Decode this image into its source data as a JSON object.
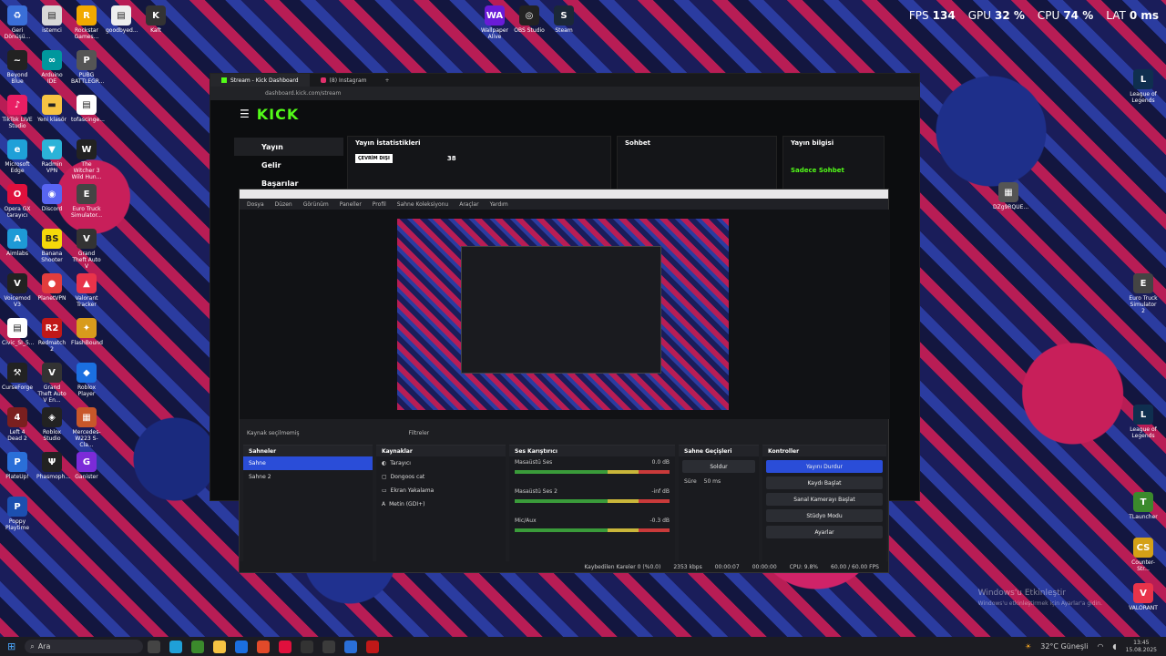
{
  "stats": [
    {
      "label": "FPS",
      "value": "134"
    },
    {
      "label": "GPU",
      "value": "32 %"
    },
    {
      "label": "CPU",
      "value": "74 %"
    },
    {
      "label": "LAT",
      "value": "0 ms"
    }
  ],
  "desktop_icons_left": [
    {
      "label": "Geri Dönüşü...",
      "color": "#3a6fd8",
      "glyph": "♻"
    },
    {
      "label": "istemci",
      "color": "#d8d8d8",
      "glyph": "▤"
    },
    {
      "label": "Rockstar Games...",
      "color": "#f2a900",
      "glyph": "R"
    },
    {
      "label": "goodbyed...",
      "color": "#eee",
      "glyph": "▤"
    },
    {
      "label": "Kaft",
      "color": "#333",
      "glyph": "K"
    },
    {
      "label": "Beyond Blue",
      "color": "#222",
      "glyph": "~"
    },
    {
      "label": "Arduino IDE",
      "color": "#00979d",
      "glyph": "∞"
    },
    {
      "label": "PUBG BATTLEGR...",
      "color": "#555",
      "glyph": "P"
    },
    {
      "label": "TikTok LIVE Studio",
      "color": "#e91e63",
      "glyph": "♪"
    },
    {
      "label": "Yeni klasör",
      "color": "#f6c343",
      "glyph": "▬"
    },
    {
      "label": "tofascinge...",
      "color": "#fff",
      "glyph": "▤"
    },
    {
      "label": "Microsoft Edge",
      "color": "#1fa0d8",
      "glyph": "e"
    },
    {
      "label": "Radmin VPN",
      "color": "#2bb3d8",
      "glyph": "▼"
    },
    {
      "label": "The Witcher 3 Wild Hun...",
      "color": "#222",
      "glyph": "W"
    },
    {
      "label": "Opera GX tarayıcı",
      "color": "#e0103d",
      "glyph": "O"
    },
    {
      "label": "Discord",
      "color": "#5865f2",
      "glyph": "◉"
    },
    {
      "label": "Euro Truck Simulator...",
      "color": "#444",
      "glyph": "E"
    },
    {
      "label": "Aimlabs",
      "color": "#1e9ad6",
      "glyph": "A"
    },
    {
      "label": "Banana Shooter",
      "color": "#f5d90a",
      "glyph": "BS"
    },
    {
      "label": "Grand Theft Auto V",
      "color": "#333",
      "glyph": "V"
    },
    {
      "label": "Voicemod V3",
      "color": "#222",
      "glyph": "V"
    },
    {
      "label": "PlanetVPN",
      "color": "#e23d3d",
      "glyph": "●"
    },
    {
      "label": "Valorant Tracker",
      "color": "#e8334a",
      "glyph": "▲"
    },
    {
      "label": "Civic_SI_5...",
      "color": "#fff",
      "glyph": "▤"
    },
    {
      "label": "Redmatch 2",
      "color": "#c01818",
      "glyph": "R2"
    },
    {
      "label": "FlashBound",
      "color": "#d89b1c",
      "glyph": "✦"
    },
    {
      "label": "CurseForge",
      "color": "#222",
      "glyph": "⚒"
    },
    {
      "label": "Grand Theft Auto V En...",
      "color": "#333",
      "glyph": "V"
    },
    {
      "label": "Roblox Player",
      "color": "#1b6fe0",
      "glyph": "◆"
    },
    {
      "label": "Left 4 Dead 2",
      "color": "#7a1f1f",
      "glyph": "4"
    },
    {
      "label": "Roblox Studio",
      "color": "#222",
      "glyph": "◈"
    },
    {
      "label": "Mercedes-W223 S-Cla...",
      "color": "#c8572a",
      "glyph": "▦"
    },
    {
      "label": "PlateUp!",
      "color": "#2a6fd8",
      "glyph": "P"
    },
    {
      "label": "Phasmoph...",
      "color": "#222",
      "glyph": "Ψ"
    },
    {
      "label": "Ganister",
      "color": "#7c2bd8",
      "glyph": "G"
    },
    {
      "label": "Poppy Playtime",
      "color": "#1c4fb0",
      "glyph": "P"
    }
  ],
  "desktop_icons_top": [
    {
      "label": "Wallpaper Alive",
      "color": "#6a1bd8",
      "glyph": "WA"
    },
    {
      "label": "OBS Studio",
      "color": "#222",
      "glyph": "◎"
    },
    {
      "label": "Steam",
      "color": "#1b2838",
      "glyph": "S"
    }
  ],
  "desktop_icons_right": [
    {
      "label": "League of Legends",
      "color": "#0f2f4f",
      "glyph": "L"
    },
    {
      "label": "DZg9RQUE...",
      "color": "#555",
      "glyph": "▦"
    },
    {
      "label": "Euro Truck Simulator 2",
      "color": "#444",
      "glyph": "E"
    },
    {
      "label": "League of Legends",
      "color": "#0f2f4f",
      "glyph": "L"
    },
    {
      "label": "TLauncher",
      "color": "#3b8a2c",
      "glyph": "T"
    },
    {
      "label": "Counter-Str...",
      "color": "#d4a017",
      "glyph": "CS"
    },
    {
      "label": "VALORANT",
      "color": "#e8334a",
      "glyph": "V"
    }
  ],
  "browser": {
    "tabs": [
      {
        "label": "Stream - Kick Dashboard"
      },
      {
        "label": "(8) Instagram"
      }
    ],
    "url": "dashboard.kick.com/stream",
    "logo": "KICK",
    "sidebar": [
      "Yayın",
      "Gelir",
      "Başarılar"
    ],
    "panels": {
      "stats_title": "Yayın İstatistikleri",
      "stats_badge": "ÇEVRİM DIŞI",
      "stats_value": "38",
      "chat_title": "Sohbet",
      "info_title": "Yayın bilgisi",
      "info_chat": "Sadece Sohbet"
    }
  },
  "obs": {
    "menu": [
      "Dosya",
      "Düzen",
      "Görünüm",
      "Paneller",
      "Profil",
      "Sahne Koleksiyonu",
      "Araçlar",
      "Yardım"
    ],
    "source_bar_label": "Kaynak seçilmemiş",
    "filters_label": "Filtreler",
    "docks": {
      "scenes": {
        "title": "Sahneler",
        "items": [
          "Sahne",
          "Sahne 2"
        ]
      },
      "sources": {
        "title": "Kaynaklar",
        "items": [
          "Tarayıcı",
          "Dongoos cat",
          "Ekran Yakalama",
          "Metin (GDI+)"
        ]
      },
      "mixer": {
        "title": "Ses Karıştırıcı",
        "channels": [
          {
            "name": "Masaüstü Ses",
            "db": "0.0 dB"
          },
          {
            "name": "Masaüstü Ses 2",
            "db": "-inf dB"
          },
          {
            "name": "Mic/Aux",
            "db": "-0.3 dB"
          }
        ]
      },
      "transitions": {
        "title": "Sahne Geçişleri",
        "type": "Soldur",
        "duration_label": "Süre",
        "duration_value": "50 ms"
      },
      "controls": {
        "title": "Kontroller",
        "buttons": [
          "Yayını Durdur",
          "Kaydı Başlat",
          "Sanal Kamerayı Başlat",
          "Stüdyo Modu",
          "Ayarlar"
        ]
      }
    },
    "status": [
      "Kaybedilen Kareler 0 (%0.0)",
      "2353 kbps",
      "00:00:07",
      "00:00:00",
      "CPU: 9.8%",
      "60.00 / 60.00 FPS"
    ]
  },
  "watermark": {
    "line1": "Windows'u Etkinleştir",
    "line2": "Windows'u etkinleştirmek için Ayarlar'a gidin."
  },
  "taskbar": {
    "search_placeholder": "Ara",
    "weather": "32°C Güneşli",
    "time": "13:45",
    "date": "15.08.2025"
  }
}
